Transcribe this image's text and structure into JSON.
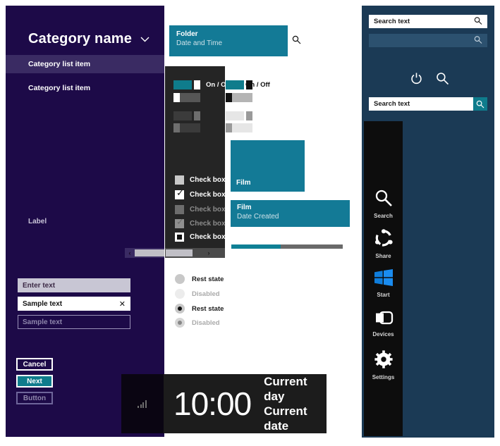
{
  "left_panel": {
    "category_title": "Category name",
    "chevron_icon": "chevron-down-icon",
    "items": [
      {
        "label": "Category list item",
        "selected": true
      },
      {
        "label": "Category list item",
        "selected": false
      }
    ],
    "label": "Label",
    "inputs": [
      {
        "value": "Enter text",
        "state": "filled-grey"
      },
      {
        "value": "Sample text",
        "state": "active",
        "clear_icon": "close-icon"
      },
      {
        "value": "Sample text",
        "state": "placeholder"
      }
    ],
    "buttons": [
      {
        "label": "Cancel",
        "style": "outline"
      },
      {
        "label": "Next",
        "style": "accent"
      },
      {
        "label": "Button",
        "style": "disabled"
      }
    ],
    "scrollbar": {
      "left_arrow": "‹",
      "right_arrow": "›"
    }
  },
  "controls": {
    "toggles_dark": [
      {
        "label": "On / Off",
        "state": "on"
      },
      {
        "label": "",
        "state": "off"
      },
      {
        "label": "",
        "state": "on-disabled"
      },
      {
        "label": "",
        "state": "off-disabled"
      }
    ],
    "toggles_light": [
      {
        "label": "On / Off",
        "state": "on"
      },
      {
        "label": "",
        "state": "off"
      },
      {
        "label": "",
        "state": "on-disabled"
      },
      {
        "label": "",
        "state": "off-disabled"
      }
    ],
    "checkboxes": [
      {
        "label": "Check box",
        "state": "unchecked"
      },
      {
        "label": "Check box",
        "state": "checked"
      },
      {
        "label": "Check box",
        "state": "unchecked-disabled"
      },
      {
        "label": "Check box",
        "state": "checked-disabled"
      },
      {
        "label": "Check box",
        "state": "indeterminate"
      }
    ],
    "radios": [
      {
        "label": "Rest state",
        "state": "unselected"
      },
      {
        "label": "Disabled",
        "state": "unselected-disabled"
      },
      {
        "label": "Rest state",
        "state": "selected"
      },
      {
        "label": "Disabled",
        "state": "selected-disabled"
      }
    ],
    "scrollbar": {
      "arrow": "›"
    }
  },
  "tiles": {
    "folder": {
      "title": "Folder",
      "subtitle": "Date and Time"
    },
    "folder_search_icon": "search-icon",
    "film_large": {
      "title": "Film"
    },
    "film_wide": {
      "title": "Film",
      "subtitle": "Date Created"
    },
    "progress": {
      "percent": 44
    }
  },
  "lock_screen": {
    "signal_icon": "signal-bars-icon",
    "time": "10:00",
    "day": "Current day",
    "date": "Current date"
  },
  "right_panel": {
    "search_boxes": [
      {
        "value": "Search text",
        "icon": "search-icon",
        "state": "rest"
      },
      {
        "value": "",
        "icon": "search-icon",
        "state": "disabled"
      },
      {
        "value": "Search text",
        "icon": "search-icon",
        "state": "accent-button"
      }
    ],
    "icons": [
      {
        "name": "power-icon",
        "glyph": "⏻"
      },
      {
        "name": "search-icon",
        "glyph": "⌕"
      }
    ]
  },
  "charms": [
    {
      "label": "Search",
      "icon": "search-icon"
    },
    {
      "label": "Share",
      "icon": "share-icon"
    },
    {
      "label": "Start",
      "icon": "windows-start-icon"
    },
    {
      "label": "Devices",
      "icon": "devices-icon"
    },
    {
      "label": "Settings",
      "icon": "settings-gear-icon"
    }
  ],
  "colors": {
    "purple": "#1d0a48",
    "purple_selected": "#3a2b63",
    "teal": "#0f7c8c",
    "tile_teal": "#137a96",
    "dark_panel": "#252525",
    "blue_panel": "#1b3a55",
    "charms_black": "#0d0d0d",
    "start_blue": "#0f7ddb"
  }
}
